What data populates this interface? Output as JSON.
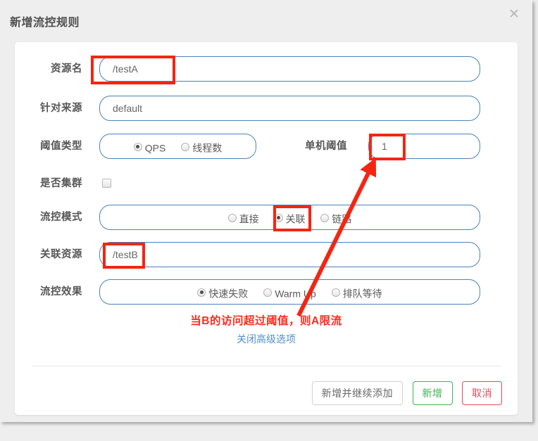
{
  "dialog": {
    "title": "新增流控规则",
    "close_icon": "close-icon",
    "close_glyph": "✕"
  },
  "form": {
    "rows": [
      {
        "label": "资源名",
        "type": "text",
        "value": "/testA"
      },
      {
        "label": "针对来源",
        "type": "text",
        "value": "default"
      },
      {
        "label": "阈值类型",
        "type": "radio",
        "options": [
          "QPS",
          "线程数"
        ],
        "selected": "QPS"
      },
      {
        "label": "单机阈值",
        "type": "text",
        "value": "1"
      },
      {
        "label": "是否集群",
        "type": "checkbox",
        "checked": false
      },
      {
        "label": "流控模式",
        "type": "radio",
        "options": [
          "直接",
          "关联",
          "链路"
        ],
        "selected": "关联"
      },
      {
        "label": "关联资源",
        "type": "text",
        "value": "/testB"
      },
      {
        "label": "流控效果",
        "type": "radio",
        "options": [
          "快速失败",
          "Warm Up",
          "排队等待"
        ],
        "selected": "快速失败"
      }
    ]
  },
  "annotation": {
    "note": "当B的访问超过阈值，则A限流",
    "note_color": "#fc2b1f",
    "highlight_color": "#f22613",
    "arrow_from": "关联",
    "arrow_to": "单机阈值"
  },
  "advanced": {
    "toggle_label": "关闭高级选项",
    "link_color": "#4f90c7"
  },
  "footer": {
    "buttons": [
      {
        "label": "新增并继续添加",
        "style": "default"
      },
      {
        "label": "新增",
        "style": "success"
      },
      {
        "label": "取消",
        "style": "danger"
      }
    ]
  }
}
